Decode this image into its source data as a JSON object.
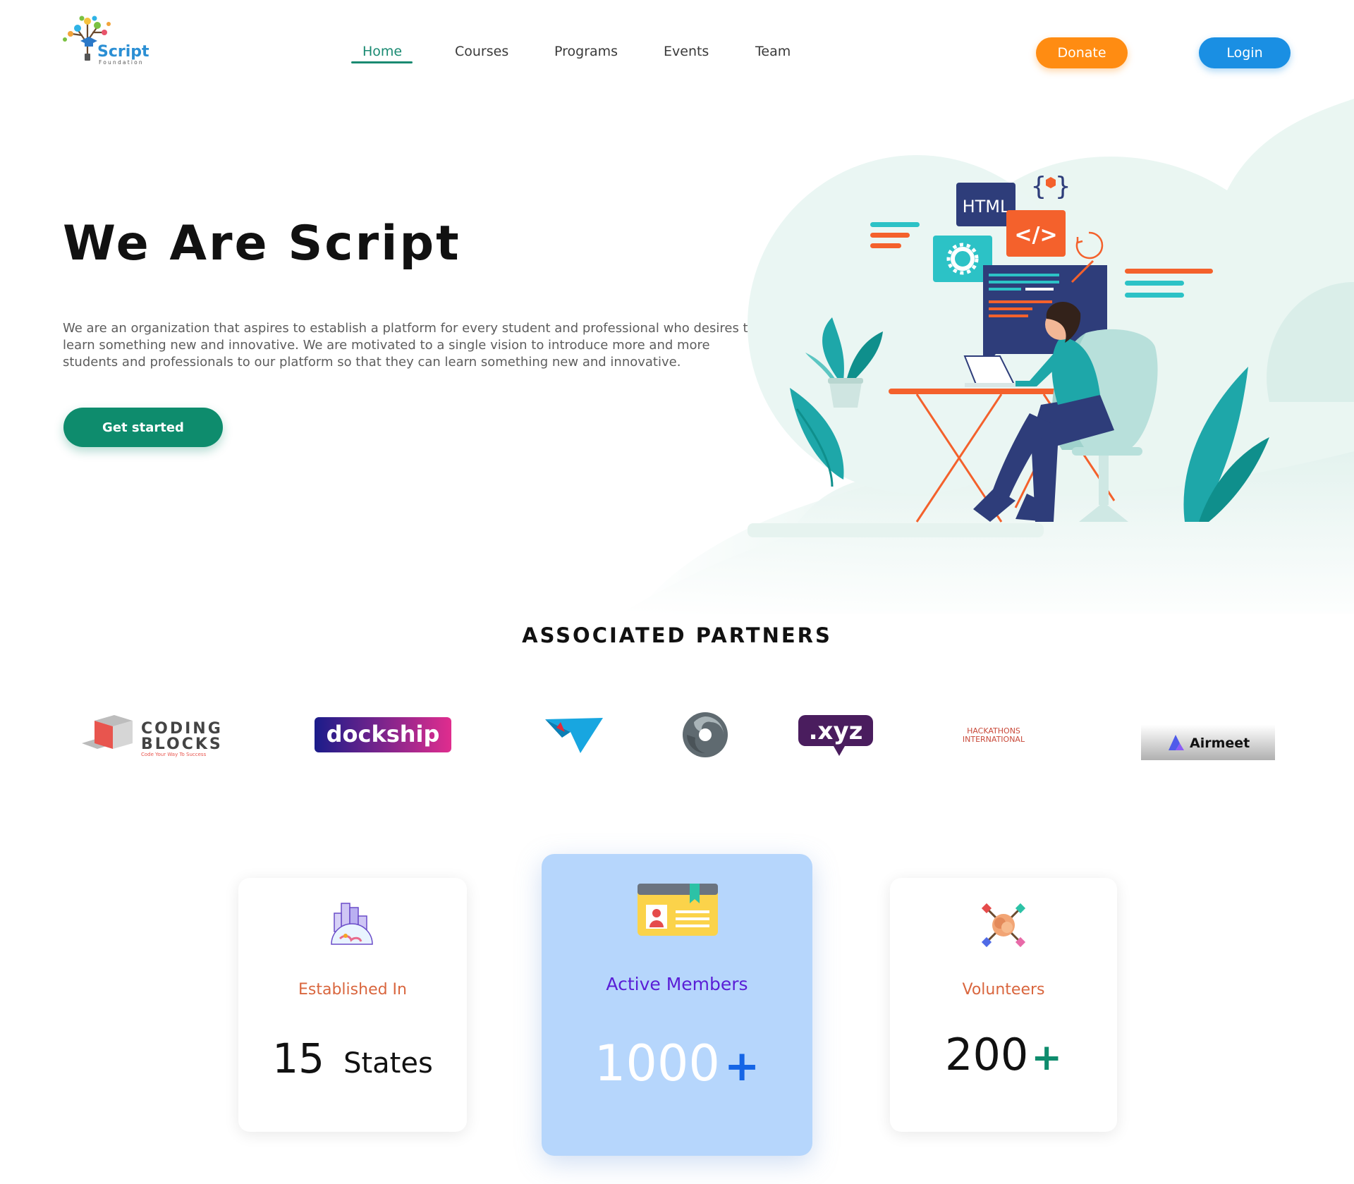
{
  "brand": {
    "logo_name": "Script",
    "logo_sub": "Foundation"
  },
  "nav": {
    "items": [
      {
        "label": "Home",
        "active": true
      },
      {
        "label": "Courses"
      },
      {
        "label": "Programs"
      },
      {
        "label": "Events"
      },
      {
        "label": "Team"
      }
    ],
    "donate_label": "Donate",
    "login_label": "Login"
  },
  "hero": {
    "title": "We Are Script",
    "description": "We are an organization that aspires to establish a platform for every student and professional who desires to learn something new and innovative. We are motivated to a single vision to introduce more and more students and professionals to our platform so that they can learn something new and innovative.",
    "cta_label": "Get started",
    "illustration": {
      "html_tag": "HTML",
      "code_tag": "</>",
      "braces_tag": "{ }"
    }
  },
  "partners": {
    "title": "ASSOCIATED PARTNERS",
    "logos": [
      {
        "name": "coding-blocks",
        "line1": "CODING",
        "line2": "BLOCKS",
        "tagline": "Code Your Way To Success"
      },
      {
        "name": "dockship",
        "text": "dockship"
      },
      {
        "name": "paper-plane",
        "text": ""
      },
      {
        "name": "swirl",
        "text": ""
      },
      {
        "name": "xyz",
        "text": ".xyz"
      },
      {
        "name": "hackathons-international",
        "line1": "HACKATHONS",
        "line2": "INTERNATIONAL"
      },
      {
        "name": "airmeet",
        "text": "Airmeet"
      }
    ]
  },
  "stats": [
    {
      "label": "Established In",
      "value": "15",
      "unit": "States",
      "icon": "city-globe-icon"
    },
    {
      "label": "Active Members",
      "value": "1000",
      "suffix": "+",
      "icon": "id-card-icon"
    },
    {
      "label": "Volunteers",
      "value": "200",
      "suffix": "+",
      "icon": "hands-together-icon"
    }
  ],
  "colors": {
    "primary_green": "#0e8c6d",
    "donate_orange": "#ff8c12",
    "login_blue": "#1a8fe3",
    "stat_label_orange": "#d9663e",
    "stat_label_purple": "#5a1ed6",
    "featured_card_bg": "#b6d6fc"
  }
}
